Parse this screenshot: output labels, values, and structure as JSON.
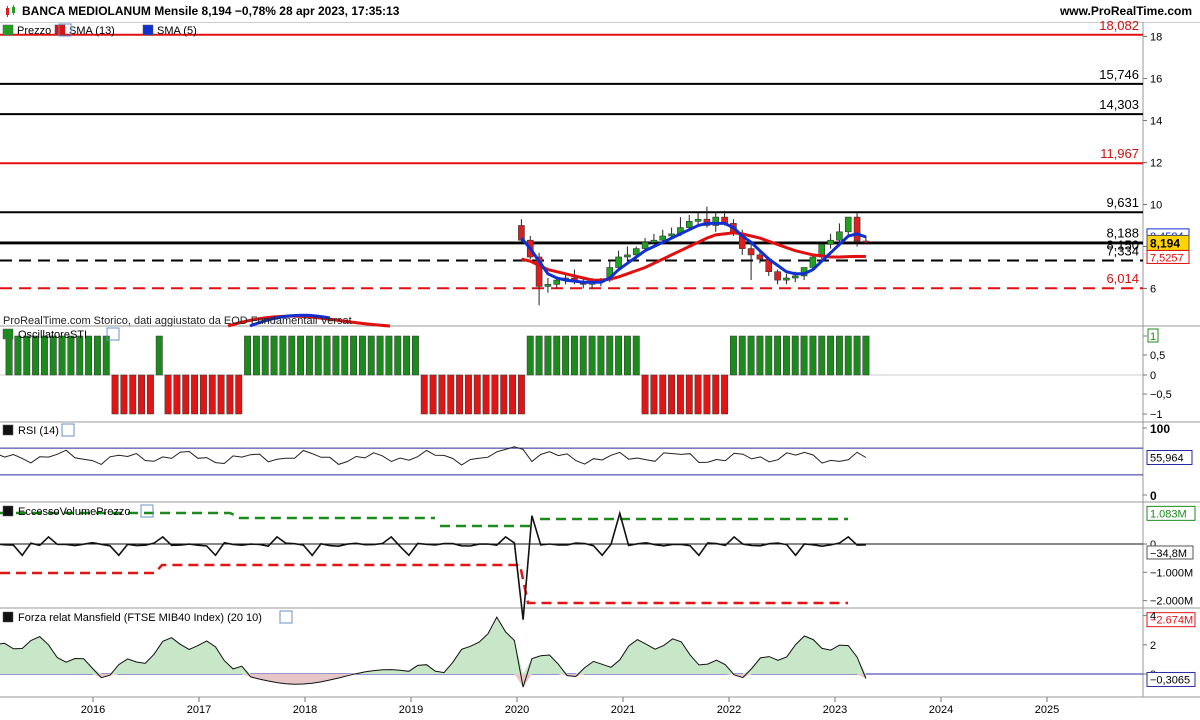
{
  "header": {
    "title": "BANCA MEDIOLANUM Mensile 8,194 −0,78% 28 apr 2023, 17:35:13",
    "site": "www.ProRealTime.com"
  },
  "colors": {
    "up": "#22a022",
    "down": "#dd1f1f",
    "sma13": "#e01010",
    "sma5": "#1030d0",
    "sti_up": "#1d8a1d",
    "sti_down": "#e01515",
    "rsi": "#222222",
    "band": "#2a2aa0",
    "mansfield_pos": "#c8e6c8",
    "mansfield_neg": "#e6c6c6"
  },
  "watermark": "ProRealTime.com Storico, dati aggiustato da EOD Fundamentali Versat",
  "panels": {
    "price": {
      "legend": [
        "Prezzo",
        "SMA (13)",
        "SMA (5)"
      ],
      "ticks": [
        "18",
        "16",
        "14",
        "12",
        "10",
        "8",
        "6"
      ],
      "hlines": [
        {
          "value": "18,082",
          "color": "#e01010",
          "dash": false
        },
        {
          "value": "15,746",
          "color": "#000000",
          "dash": false
        },
        {
          "value": "14,303",
          "color": "#000000",
          "dash": false
        },
        {
          "value": "11,967",
          "color": "#e01010",
          "dash": false
        },
        {
          "value": "9,631",
          "color": "#000000",
          "dash": false
        },
        {
          "value": "8,188",
          "color": "#000000",
          "dash": false
        },
        {
          "value": "8,150",
          "color": "#000000",
          "dash": false
        },
        {
          "value": "7,334",
          "color": "#000000",
          "dash": true
        },
        {
          "value": "6,014",
          "color": "#e01010",
          "dash": true
        }
      ],
      "label_sma5": "8,4584",
      "label_last": "8,194",
      "label_sma13": "7,5257"
    },
    "sti": {
      "legend": "OscillatoreSTI",
      "ticks": [
        "1",
        "0,5",
        "0",
        "−0,5",
        "−1"
      ]
    },
    "rsi": {
      "legend": "RSI (14)",
      "ticks": [
        "100",
        "0"
      ],
      "label_last": "55,964"
    },
    "evp": {
      "legend": "EccessoVolumePrezzo",
      "ticks": [
        "0",
        "−1.000M",
        "−2.000M"
      ],
      "label_upper": "1.083M",
      "label_last": "−34,8M",
      "label_lower": "−2.674M"
    },
    "mansfield": {
      "legend": "Forza relat Mansfield (FTSE MIB40 Index) (20 10)",
      "ticks": [
        "4",
        "2",
        "0"
      ],
      "label_last": "−0,3065"
    }
  },
  "x_axis": {
    "labels": [
      "2016",
      "2017",
      "2018",
      "2019",
      "2020",
      "2021",
      "2022",
      "2023",
      "2024",
      "2025"
    ]
  },
  "chart_data": [
    {
      "type": "candlestick",
      "title": "BANCA MEDIOLANUM Mensile",
      "x": [
        "2020-01",
        "2020-02",
        "2020-03",
        "2020-04",
        "2020-05",
        "2020-06",
        "2020-07",
        "2020-08",
        "2020-09",
        "2020-10",
        "2020-11",
        "2020-12",
        "2021-01",
        "2021-02",
        "2021-03",
        "2021-04",
        "2021-05",
        "2021-06",
        "2021-07",
        "2021-08",
        "2021-09",
        "2021-10",
        "2021-11",
        "2021-12",
        "2022-01",
        "2022-02",
        "2022-03",
        "2022-04",
        "2022-05",
        "2022-06",
        "2022-07",
        "2022-08",
        "2022-09",
        "2022-10",
        "2022-11",
        "2022-12",
        "2023-01",
        "2023-02",
        "2023-03",
        "2023-04"
      ],
      "open": [
        9.0,
        8.3,
        7.5,
        6.1,
        6.2,
        6.4,
        6.5,
        6.3,
        6.2,
        6.3,
        6.4,
        7.0,
        7.5,
        7.6,
        7.9,
        8.2,
        8.3,
        8.5,
        8.6,
        8.9,
        9.2,
        9.3,
        9.0,
        9.4,
        9.1,
        8.6,
        7.9,
        7.6,
        7.4,
        6.8,
        6.4,
        6.5,
        6.6,
        7.0,
        7.5,
        8.1,
        8.3,
        8.7,
        9.4,
        8.26
      ],
      "high": [
        9.3,
        8.5,
        7.7,
        6.5,
        6.5,
        6.7,
        6.9,
        6.5,
        6.5,
        6.5,
        7.3,
        7.8,
        8.0,
        8.0,
        8.4,
        8.6,
        8.8,
        8.9,
        9.4,
        9.5,
        9.6,
        9.9,
        9.6,
        9.7,
        9.3,
        8.8,
        8.2,
        7.8,
        7.5,
        6.9,
        6.7,
        6.8,
        6.8,
        7.6,
        8.2,
        8.6,
        9.1,
        9.4,
        9.6,
        8.5
      ],
      "low": [
        8.2,
        7.4,
        5.2,
        5.8,
        6.0,
        6.2,
        6.2,
        6.0,
        6.0,
        6.1,
        6.3,
        6.9,
        7.3,
        7.4,
        7.8,
        8.1,
        8.2,
        8.4,
        8.5,
        8.8,
        9.0,
        8.9,
        8.7,
        9.0,
        8.5,
        7.6,
        6.4,
        7.2,
        6.6,
        6.2,
        6.2,
        6.3,
        6.4,
        6.9,
        7.4,
        7.9,
        8.0,
        8.5,
        8.0,
        8.15
      ],
      "close": [
        8.3,
        7.5,
        6.1,
        6.2,
        6.4,
        6.5,
        6.3,
        6.2,
        6.3,
        6.4,
        7.0,
        7.5,
        7.6,
        7.9,
        8.2,
        8.3,
        8.5,
        8.6,
        8.9,
        9.2,
        9.3,
        9.0,
        9.4,
        9.1,
        8.6,
        7.9,
        7.6,
        7.4,
        6.8,
        6.4,
        6.5,
        6.6,
        7.0,
        7.5,
        8.1,
        8.3,
        8.7,
        9.4,
        8.26,
        8.194
      ],
      "sma5": [
        8.4,
        7.9,
        7.3,
        6.7,
        6.5,
        6.4,
        6.35,
        6.3,
        6.3,
        6.3,
        6.5,
        6.9,
        7.2,
        7.5,
        7.8,
        8.0,
        8.2,
        8.4,
        8.6,
        8.8,
        9.0,
        9.1,
        9.1,
        9.1,
        8.9,
        8.5,
        8.2,
        7.8,
        7.4,
        7.1,
        6.8,
        6.7,
        6.7,
        6.9,
        7.3,
        7.7,
        8.1,
        8.5,
        8.6,
        8.4584
      ],
      "sma13": [
        7.4,
        7.3,
        7.1,
        6.9,
        6.8,
        6.7,
        6.6,
        6.5,
        6.4,
        6.4,
        6.45,
        6.55,
        6.7,
        6.85,
        7.0,
        7.2,
        7.4,
        7.6,
        7.8,
        8.0,
        8.2,
        8.4,
        8.55,
        8.6,
        8.65,
        8.6,
        8.5,
        8.4,
        8.25,
        8.1,
        7.95,
        7.8,
        7.7,
        7.6,
        7.55,
        7.5,
        7.5,
        7.52,
        7.53,
        7.5257
      ],
      "ylim": [
        4.5,
        18.5
      ]
    },
    {
      "type": "bar",
      "title": "OscillatoreSTI",
      "categories": [
        "2015-03",
        "2015-04",
        "2015-05",
        "2015-06",
        "2015-07",
        "2015-08",
        "2015-09",
        "2015-10",
        "2015-11",
        "2015-12",
        "2016-01",
        "2016-02",
        "2016-03",
        "2016-04",
        "2016-05",
        "2016-06",
        "2016-07",
        "2016-08",
        "2016-09",
        "2016-10",
        "2016-11",
        "2016-12",
        "2017-01",
        "2017-02",
        "2017-03",
        "2017-04",
        "2017-05",
        "2017-06",
        "2017-07",
        "2017-08",
        "2017-09",
        "2017-10",
        "2017-11",
        "2017-12",
        "2018-01",
        "2018-02",
        "2018-03",
        "2018-04",
        "2018-05",
        "2018-06",
        "2018-07",
        "2018-08",
        "2018-09",
        "2018-10",
        "2018-11",
        "2018-12",
        "2019-01",
        "2019-02",
        "2019-03",
        "2019-04",
        "2019-05",
        "2019-06",
        "2019-07",
        "2019-08",
        "2019-09",
        "2019-10",
        "2019-11",
        "2019-12",
        "2020-01",
        "2020-02",
        "2020-03",
        "2020-04",
        "2020-05",
        "2020-06",
        "2020-07",
        "2020-08",
        "2020-09",
        "2020-10",
        "2020-11",
        "2020-12",
        "2021-01",
        "2021-02",
        "2021-03",
        "2021-04",
        "2021-05",
        "2021-06",
        "2021-07",
        "2021-08",
        "2021-09",
        "2021-10",
        "2021-11",
        "2021-12",
        "2022-01",
        "2022-02",
        "2022-03",
        "2022-04",
        "2022-05",
        "2022-06",
        "2022-07",
        "2022-08",
        "2022-09",
        "2022-10",
        "2022-11",
        "2022-12",
        "2023-01",
        "2023-02",
        "2023-03",
        "2023-04"
      ],
      "values": [
        1,
        1,
        1,
        1,
        1,
        1,
        1,
        1,
        1,
        1,
        1,
        1,
        -1,
        -1,
        -1,
        -1,
        -1,
        1,
        -1,
        -1,
        -1,
        -1,
        -1,
        -1,
        -1,
        -1,
        -1,
        1,
        1,
        1,
        1,
        1,
        1,
        1,
        1,
        1,
        1,
        1,
        1,
        1,
        1,
        1,
        1,
        1,
        1,
        1,
        1,
        -1,
        -1,
        -1,
        -1,
        -1,
        -1,
        -1,
        -1,
        -1,
        -1,
        -1,
        -1,
        1,
        1,
        1,
        1,
        1,
        1,
        1,
        1,
        1,
        1,
        1,
        1,
        1,
        -1,
        -1,
        -1,
        -1,
        -1,
        -1,
        -1,
        -1,
        -1,
        -1,
        1,
        1,
        1,
        1,
        1,
        1,
        1,
        1,
        1,
        1,
        1,
        1,
        1,
        1,
        1,
        1,
        1,
        1
      ],
      "ylim": [
        -1,
        1
      ]
    },
    {
      "type": "line",
      "title": "RSI (14)",
      "last": 55.964,
      "ylim": [
        0,
        100
      ],
      "bands": [
        70,
        30
      ]
    },
    {
      "type": "line",
      "title": "EccessoVolumePrezzo",
      "last": -34.8,
      "upper": 1083,
      "lower": -2674,
      "unit": "M"
    },
    {
      "type": "area",
      "title": "Forza relat Mansfield (FTSE MIB40 Index) (20 10)",
      "last": -0.3065,
      "ylim": [
        -1.2,
        4.2
      ]
    }
  ]
}
